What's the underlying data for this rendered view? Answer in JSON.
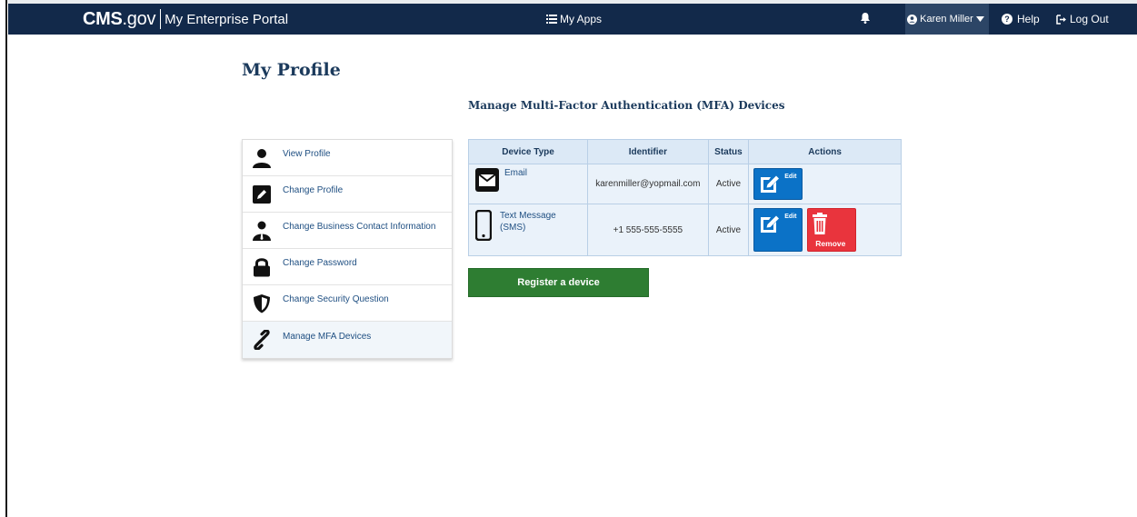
{
  "header": {
    "brand_cms": "CMS",
    "brand_gov": ".gov",
    "brand_portal": "My Enterprise Portal",
    "my_apps": "My Apps",
    "user_name": "Karen Miller",
    "help": "Help",
    "log_out": "Log Out"
  },
  "page": {
    "title": "My Profile",
    "section_title": "Manage Multi-Factor Authentication (MFA) Devices"
  },
  "sidebar": {
    "items": [
      {
        "label": "View Profile",
        "icon": "user-icon"
      },
      {
        "label": "Change Profile",
        "icon": "pencil-icon"
      },
      {
        "label": "Change Business Contact Information",
        "icon": "business-contact-icon"
      },
      {
        "label": "Change Password",
        "icon": "lock-icon"
      },
      {
        "label": "Change Security Question",
        "icon": "shield-icon"
      },
      {
        "label": "Manage MFA Devices",
        "icon": "link-icon",
        "active": true
      }
    ]
  },
  "table": {
    "headers": [
      "Device Type",
      "Identifier",
      "Status",
      "Actions"
    ],
    "rows": [
      {
        "device_type": "Email",
        "icon": "envelope-icon",
        "identifier": "karenmiller@yopmail.com",
        "status": "Active",
        "actions": [
          "Edit"
        ]
      },
      {
        "device_type": "Text Message (SMS)",
        "icon": "mobile-phone-icon",
        "identifier": "+1 555-555-5555",
        "status": "Active",
        "actions": [
          "Edit",
          "Remove"
        ]
      }
    ],
    "edit_label": "Edit",
    "remove_label": "Remove"
  },
  "register_button": "Register a device",
  "colors": {
    "nav_bg": "#12294a",
    "heading": "#1b3a5c",
    "link": "#1f4f82",
    "edit_btn": "#0b72c7",
    "remove_btn": "#e9343d",
    "register_btn": "#2e7d32",
    "table_header": "#dce9f6",
    "table_cell": "#eaf2fa"
  }
}
